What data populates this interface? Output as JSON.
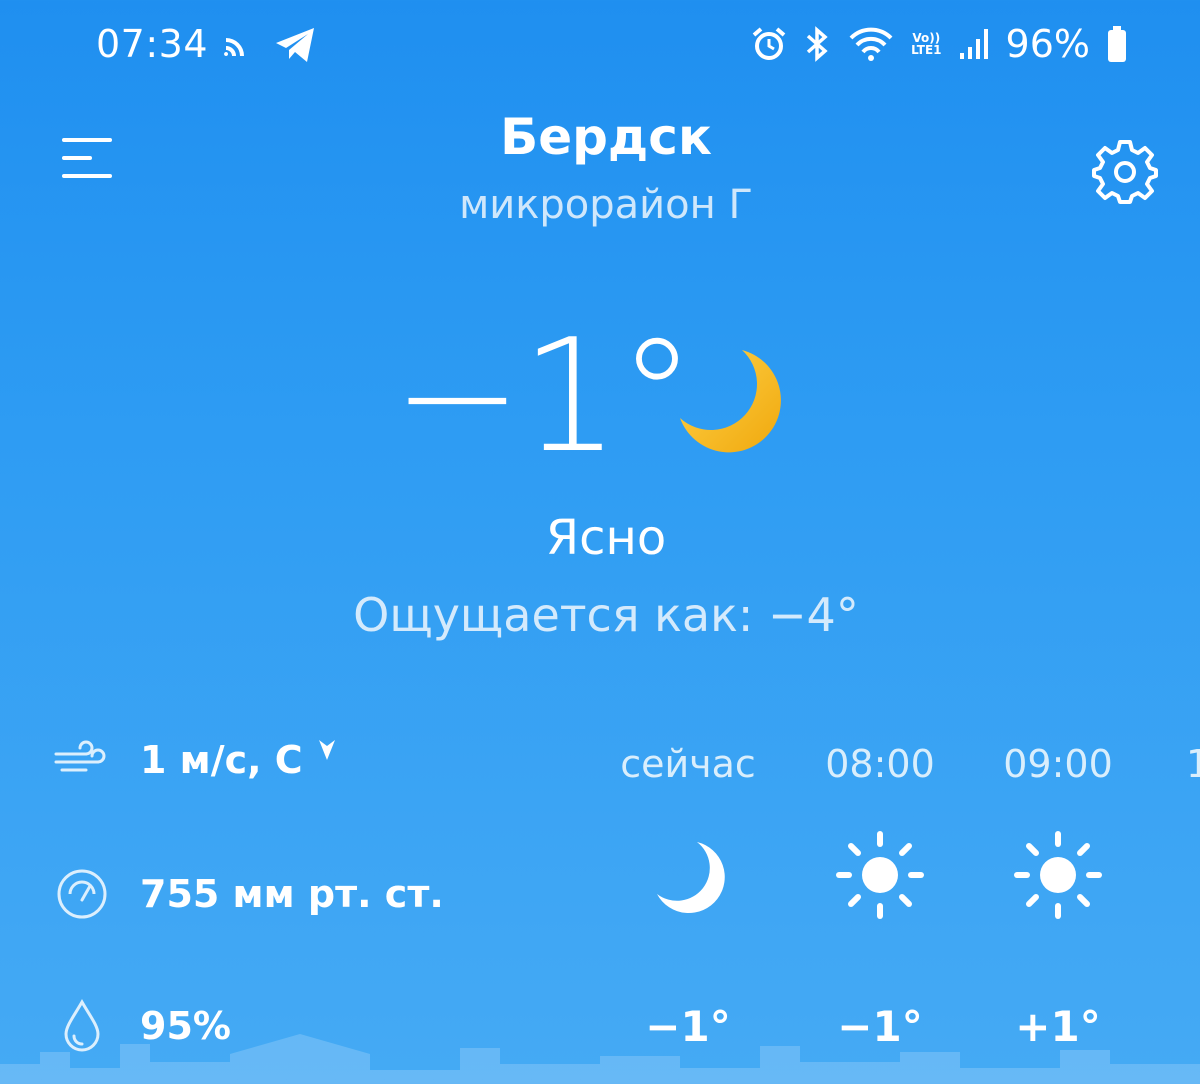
{
  "status_bar": {
    "time": "07:34",
    "lte_top": "Vo))",
    "lte_bottom": "LTE1",
    "battery": "96%"
  },
  "header": {
    "city": "Бердск",
    "district": "микрорайон Г"
  },
  "current": {
    "temperature": "−1°",
    "condition": "Ясно",
    "feels_like": "Ощущается как: −4°",
    "icon": "moon-icon"
  },
  "details": {
    "wind": "1 м/с, С",
    "pressure": "755 мм рт. ст.",
    "humidity": "95%"
  },
  "hourly": [
    {
      "label": "сейчас",
      "icon": "moon-icon",
      "temp": "−1°"
    },
    {
      "label": "08:00",
      "icon": "sun-icon",
      "temp": "−1°"
    },
    {
      "label": "09:00",
      "icon": "sun-icon",
      "temp": "+1°"
    }
  ],
  "hourly_partial": "1",
  "colors": {
    "background_top": "#1f8ff0",
    "background_bottom": "#45aaf4",
    "moon_accent": "#f5b418"
  }
}
